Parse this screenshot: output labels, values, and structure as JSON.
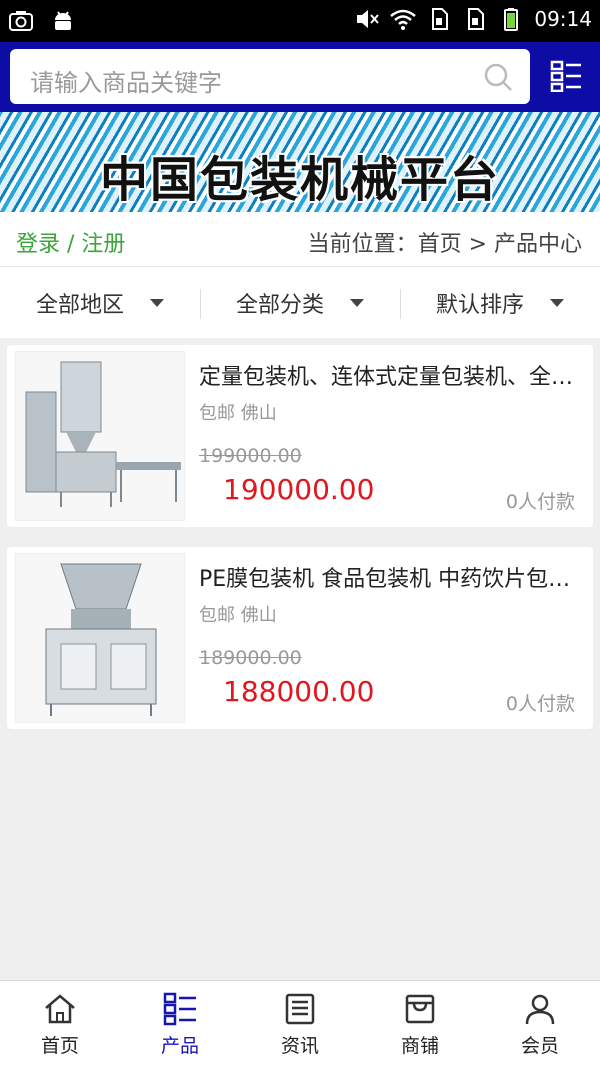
{
  "statusbar": {
    "time": "09:14"
  },
  "search": {
    "placeholder": "请输入商品关键字"
  },
  "banner": {
    "title": "中国包装机械平台"
  },
  "infobar": {
    "login": "登录 / 注册",
    "breadcrumb": "当前位置：首页 > 产品中心"
  },
  "filters": [
    {
      "label": "全部地区"
    },
    {
      "label": "全部分类"
    },
    {
      "label": "默认排序"
    }
  ],
  "products": [
    {
      "title": "定量包装机、连体式定量包装机、全自动包装机",
      "location": "包邮 佛山",
      "original_price": "199000.00",
      "price": "190000.00",
      "sold": "0人付款"
    },
    {
      "title": "PE膜包装机 食品包装机 中药饮片包装机",
      "location": "包邮 佛山",
      "original_price": "189000.00",
      "price": "188000.00",
      "sold": "0人付款"
    }
  ],
  "bottomnav": [
    {
      "label": "首页",
      "icon": "home-icon"
    },
    {
      "label": "产品",
      "icon": "list-icon",
      "active": true
    },
    {
      "label": "资讯",
      "icon": "news-icon"
    },
    {
      "label": "商铺",
      "icon": "shop-icon"
    },
    {
      "label": "会员",
      "icon": "user-icon"
    }
  ],
  "colors": {
    "header": "#0d0da6",
    "price": "#e0181e",
    "login": "#39a53a",
    "active_nav": "#1616b5"
  }
}
